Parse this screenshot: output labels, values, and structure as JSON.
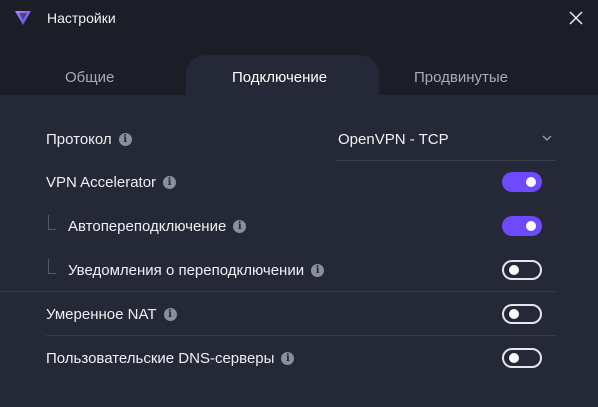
{
  "window": {
    "title": "Настройки"
  },
  "tabs": [
    {
      "label": "Общие"
    },
    {
      "label": "Подключение",
      "active": true
    },
    {
      "label": "Продвинутые"
    }
  ],
  "settings": {
    "protocol": {
      "label": "Протокол",
      "value": "OpenVPN - TCP"
    },
    "vpn_accelerator": {
      "label": "VPN Accelerator",
      "enabled": true
    },
    "auto_reconnect": {
      "label": "Автопереподключение",
      "enabled": true
    },
    "reconnect_notifications": {
      "label": "Уведомления о переподключении",
      "enabled": false
    },
    "moderate_nat": {
      "label": "Умеренное NAT",
      "enabled": false
    },
    "custom_dns": {
      "label": "Пользовательские DNS-серверы",
      "enabled": false
    }
  },
  "colors": {
    "accent": "#6d4aff",
    "background": "#252836",
    "titlebar": "#1c1e27"
  },
  "icons": [
    "proton-vpn-logo",
    "close-icon",
    "info-icon",
    "chevron-down-icon"
  ]
}
